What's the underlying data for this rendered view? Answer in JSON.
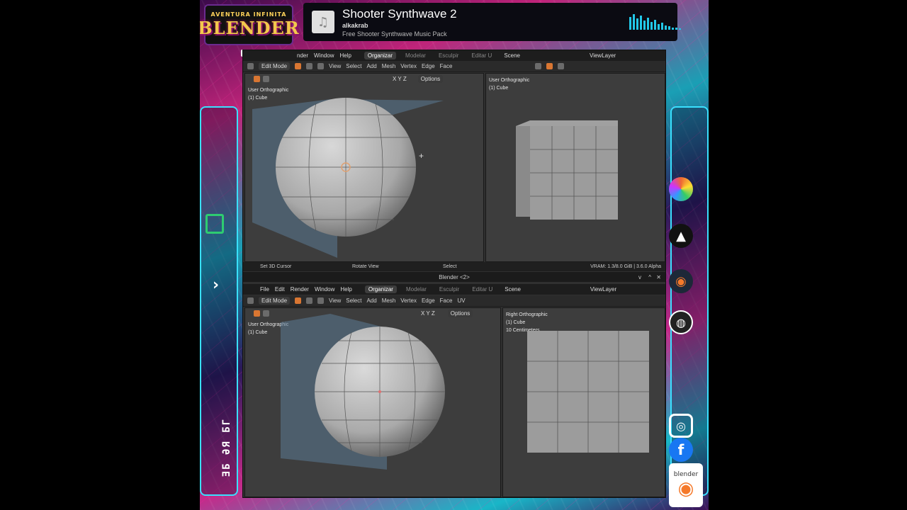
{
  "overlay": {
    "logo_top": "AVENTURA INFINITA",
    "logo_main": "BLENDER",
    "vertical_text": "ƎБ ƏЯ БГ"
  },
  "music": {
    "title": "Shooter Synthwave 2",
    "artist": "alkakrab",
    "album": "Free Shooter Synthwave Music Pack",
    "icon": "music-note-icon"
  },
  "blender": {
    "menu_top": [
      "nder",
      "Window",
      "Help"
    ],
    "menu_bottom": [
      "File",
      "Edit",
      "Render",
      "Window",
      "Help"
    ],
    "workspaces": [
      "Organizar",
      "Modelar",
      "Esculpir",
      "Editar U"
    ],
    "scene": "Scene",
    "view_layer": "ViewLayer",
    "mode": "Edit Mode",
    "tool_menus": [
      "View",
      "Select",
      "Add",
      "Mesh",
      "Vertex",
      "Edge",
      "Face"
    ],
    "tool_menus_bottom": [
      "View",
      "Select",
      "Add",
      "Mesh",
      "Vertex",
      "Edge",
      "Face",
      "UV"
    ],
    "axes": "X Y Z",
    "options": "Options",
    "window_title": "Blender <2>",
    "viewports": {
      "top_left": {
        "line1": "User Orthographic",
        "line2": "(1) Cube"
      },
      "top_right": {
        "line1": "User Orthographic",
        "line2": "(1) Cube"
      },
      "bottom_left": {
        "line1": "User Orthographic",
        "line2": "(1) Cube"
      },
      "bottom_right": {
        "line1": "Right Orthographic",
        "line2": "(1) Cube",
        "line3": "10 Centimeters"
      }
    },
    "status": {
      "left": "Set 3D Cursor",
      "middle": "Rotate View",
      "right": "Select",
      "vram": "VRAM: 1.3/8.0 GiB | 3.6.0 Alpha"
    }
  },
  "social": {
    "badge_text": "blender",
    "icons": [
      "paint-app-icon",
      "inkscape-icon",
      "blender-icon",
      "obs-icon",
      "instagram-icon",
      "facebook-icon"
    ]
  },
  "colors": {
    "accent_orange": "#d97632",
    "cyan": "#39e0ff",
    "bg_dark": "#303030"
  }
}
